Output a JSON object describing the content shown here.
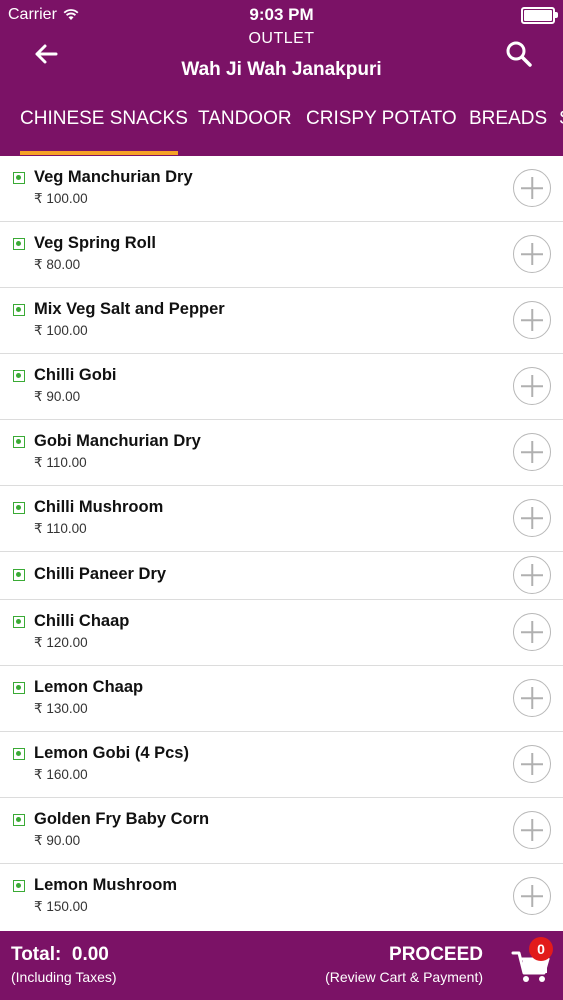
{
  "status_bar": {
    "carrier": "Carrier",
    "time": "9:03 PM"
  },
  "header": {
    "outlet_label": "OUTLET",
    "outlet_name": "Wah Ji Wah Janakpuri",
    "back_icon": "arrow-left-icon",
    "search_icon": "search-icon"
  },
  "tabs": [
    {
      "label": "CHINESE SNACKS",
      "active": true
    },
    {
      "label": "TANDOOR",
      "active": false
    },
    {
      "label": "CRISPY POTATO",
      "active": false
    },
    {
      "label": "BREADS",
      "active": false
    },
    {
      "label": "S",
      "active": false
    }
  ],
  "items": [
    {
      "name": "Veg Manchurian Dry",
      "price": "₹ 100.00"
    },
    {
      "name": "Veg Spring Roll",
      "price": "₹ 80.00"
    },
    {
      "name": "Mix Veg Salt and Pepper",
      "price": "₹ 100.00"
    },
    {
      "name": "Chilli Gobi",
      "price": "₹ 90.00"
    },
    {
      "name": "Gobi Manchurian Dry",
      "price": "₹ 110.00"
    },
    {
      "name": "Chilli Mushroom",
      "price": "₹ 110.00"
    },
    {
      "name": "Chilli Paneer Dry",
      "price": ""
    },
    {
      "name": "Chilli Chaap",
      "price": "₹ 120.00"
    },
    {
      "name": "Lemon Chaap",
      "price": "₹ 130.00"
    },
    {
      "name": "Lemon Gobi (4 Pcs)",
      "price": "₹ 160.00"
    },
    {
      "name": "Golden Fry Baby Corn",
      "price": "₹ 90.00"
    },
    {
      "name": "Lemon Mushroom",
      "price": "₹ 150.00"
    }
  ],
  "footer": {
    "total_label": "Total:",
    "total_value": "0.00",
    "taxes_note": "(Including Taxes)",
    "proceed_label": "PROCEED",
    "proceed_note": "(Review Cart & Payment)",
    "cart_count": "0",
    "cart_icon": "cart-icon"
  },
  "colors": {
    "brand": "#7b1266",
    "accent": "#f5a226",
    "veg": "#3aaa35",
    "badge": "#e21b1b"
  }
}
